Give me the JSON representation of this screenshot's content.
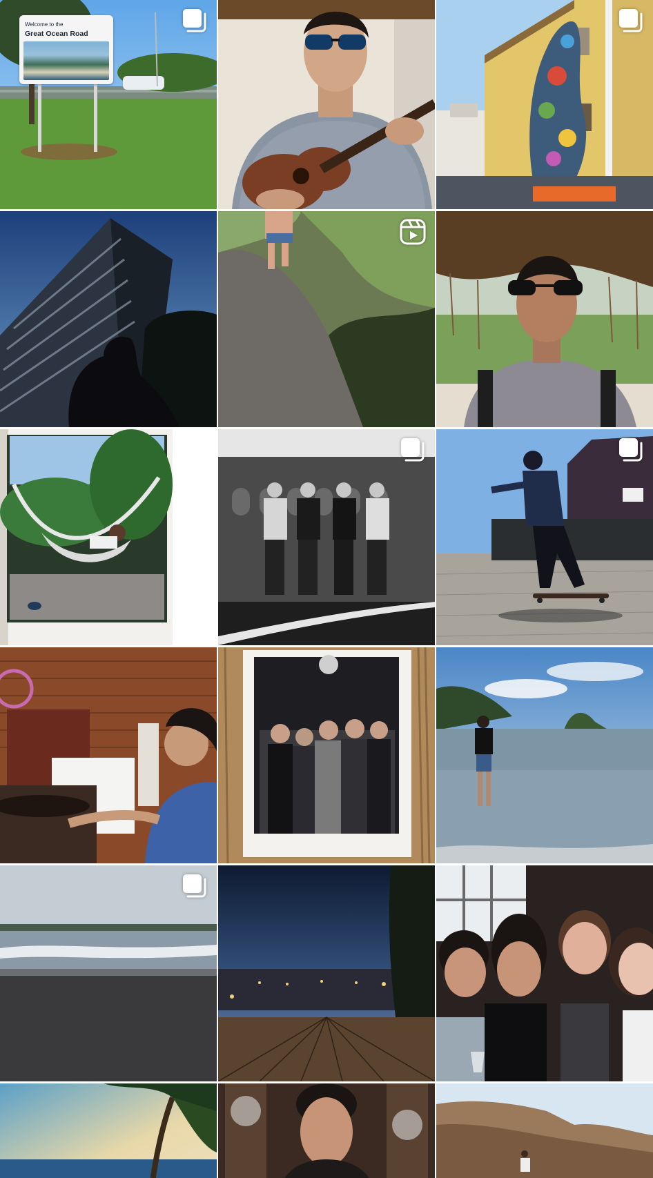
{
  "grid": {
    "posts": [
      {
        "kind": "carousel",
        "badge_icon": "multiple-posts-icon",
        "caption_lines": [
          "Welcome to the",
          "Great Ocean Road"
        ]
      },
      {
        "kind": "photo",
        "badge_icon": ""
      },
      {
        "kind": "carousel",
        "badge_icon": "multiple-posts-icon"
      },
      {
        "kind": "photo",
        "badge_icon": ""
      },
      {
        "kind": "reel",
        "badge_icon": "reel-icon"
      },
      {
        "kind": "photo",
        "badge_icon": ""
      },
      {
        "kind": "photo",
        "badge_icon": ""
      },
      {
        "kind": "carousel",
        "badge_icon": "multiple-posts-icon"
      },
      {
        "kind": "carousel",
        "badge_icon": "multiple-posts-icon"
      },
      {
        "kind": "photo",
        "badge_icon": ""
      },
      {
        "kind": "photo",
        "badge_icon": ""
      },
      {
        "kind": "photo",
        "badge_icon": ""
      },
      {
        "kind": "carousel",
        "badge_icon": "multiple-posts-icon"
      },
      {
        "kind": "photo",
        "badge_icon": ""
      },
      {
        "kind": "photo",
        "badge_icon": ""
      },
      {
        "kind": "photo",
        "badge_icon": ""
      },
      {
        "kind": "photo",
        "badge_icon": ""
      },
      {
        "kind": "photo",
        "badge_icon": ""
      }
    ]
  },
  "colors": {
    "background": "#ffffff",
    "badge": "#ffffff"
  }
}
